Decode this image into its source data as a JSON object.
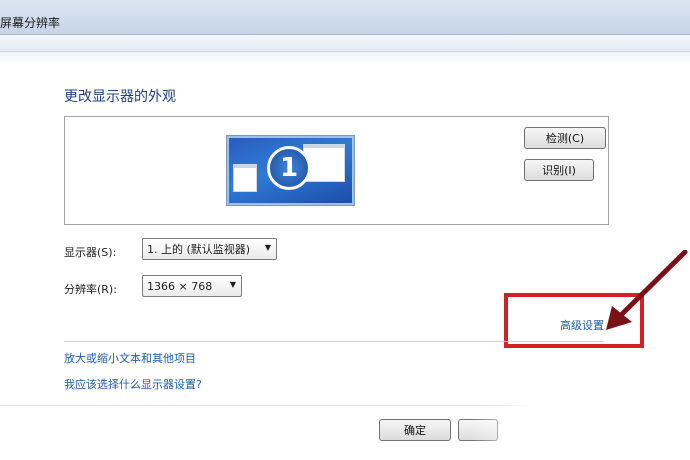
{
  "window": {
    "title": "屏幕分辨率"
  },
  "main": {
    "heading": "更改显示器的外观",
    "monitor_number": "1",
    "detect_button": "检测(C)",
    "identify_button": "识别(I)",
    "display_label": "显示器(S):",
    "display_value": "1. 上的 (默认监视器)",
    "resolution_label": "分辨率(R):",
    "resolution_value": "1366 × 768",
    "advanced_link": "高级设置",
    "text_size_link": "放大或缩小文本和其他项目",
    "which_settings_link": "我应该选择什么显示器设置?",
    "ok_button": "确定"
  },
  "colors": {
    "highlight": "#d3202b",
    "link": "#1f5bb5",
    "heading": "#1f3f8a"
  }
}
